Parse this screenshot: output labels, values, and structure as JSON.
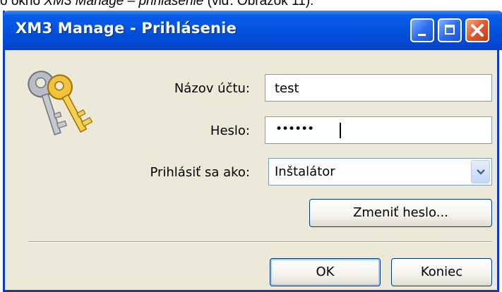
{
  "document": {
    "caption_before": "o okno ",
    "caption_italic": "XM3 Manage – prihlásenie",
    "caption_after": " (viď. Obrázok 11)."
  },
  "window": {
    "title": "XM3 Manage - Prihlásenie",
    "accent_color": "#0354e0",
    "close_color": "#e05a2e"
  },
  "form": {
    "account_label": "Názov účtu:",
    "account_value": "test",
    "password_label": "Heslo:",
    "password_mask": "••••••",
    "role_label": "Prihlásiť sa ako:",
    "role_value": "Inštalátor",
    "change_password_label": "Zmeniť heslo..."
  },
  "buttons": {
    "ok_label": "OK",
    "exit_label": "Koniec"
  },
  "icons": [
    "keys-icon",
    "minimize-icon",
    "maximize-icon",
    "close-icon",
    "chevron-down-icon"
  ]
}
